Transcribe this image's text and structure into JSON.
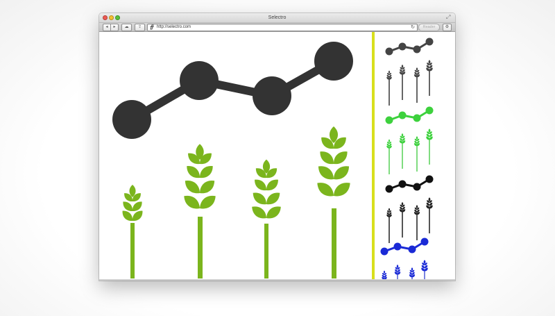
{
  "window": {
    "title": "Selectro"
  },
  "toolbar": {
    "back_icon": "◂",
    "forward_icon": "▸",
    "icloud_icon": "☁",
    "share_icon": "⇪",
    "url": "http://selectro.com",
    "reader_label": "Reader",
    "settings_icon": "⚙",
    "fullscreen_icon": "⤢"
  },
  "icons": {
    "favicon": "selectro-favicon",
    "reload": "reload-icon"
  },
  "main_graphic": {
    "description_icon": "growth-chart-wheat-logo",
    "node_color": "#333333",
    "plant_color": "#7bb51d"
  },
  "divider_color": "#d9df1c",
  "thumbnails": [
    {
      "name": "thumbnail-gray",
      "node_color": "#444444",
      "plant_color": "#444444",
      "stem_color": "#666666"
    },
    {
      "name": "thumbnail-green",
      "node_color": "#3dd13d",
      "plant_color": "#3dd13d",
      "stem_color": "#7fdc7f"
    },
    {
      "name": "thumbnail-black",
      "node_color": "#111111",
      "plant_color": "#222222",
      "stem_color": "#555555"
    },
    {
      "name": "thumbnail-blue",
      "node_color": "#1a2ad6",
      "plant_color": "#1a2ad6",
      "stem_color": "#7a84e0"
    }
  ]
}
